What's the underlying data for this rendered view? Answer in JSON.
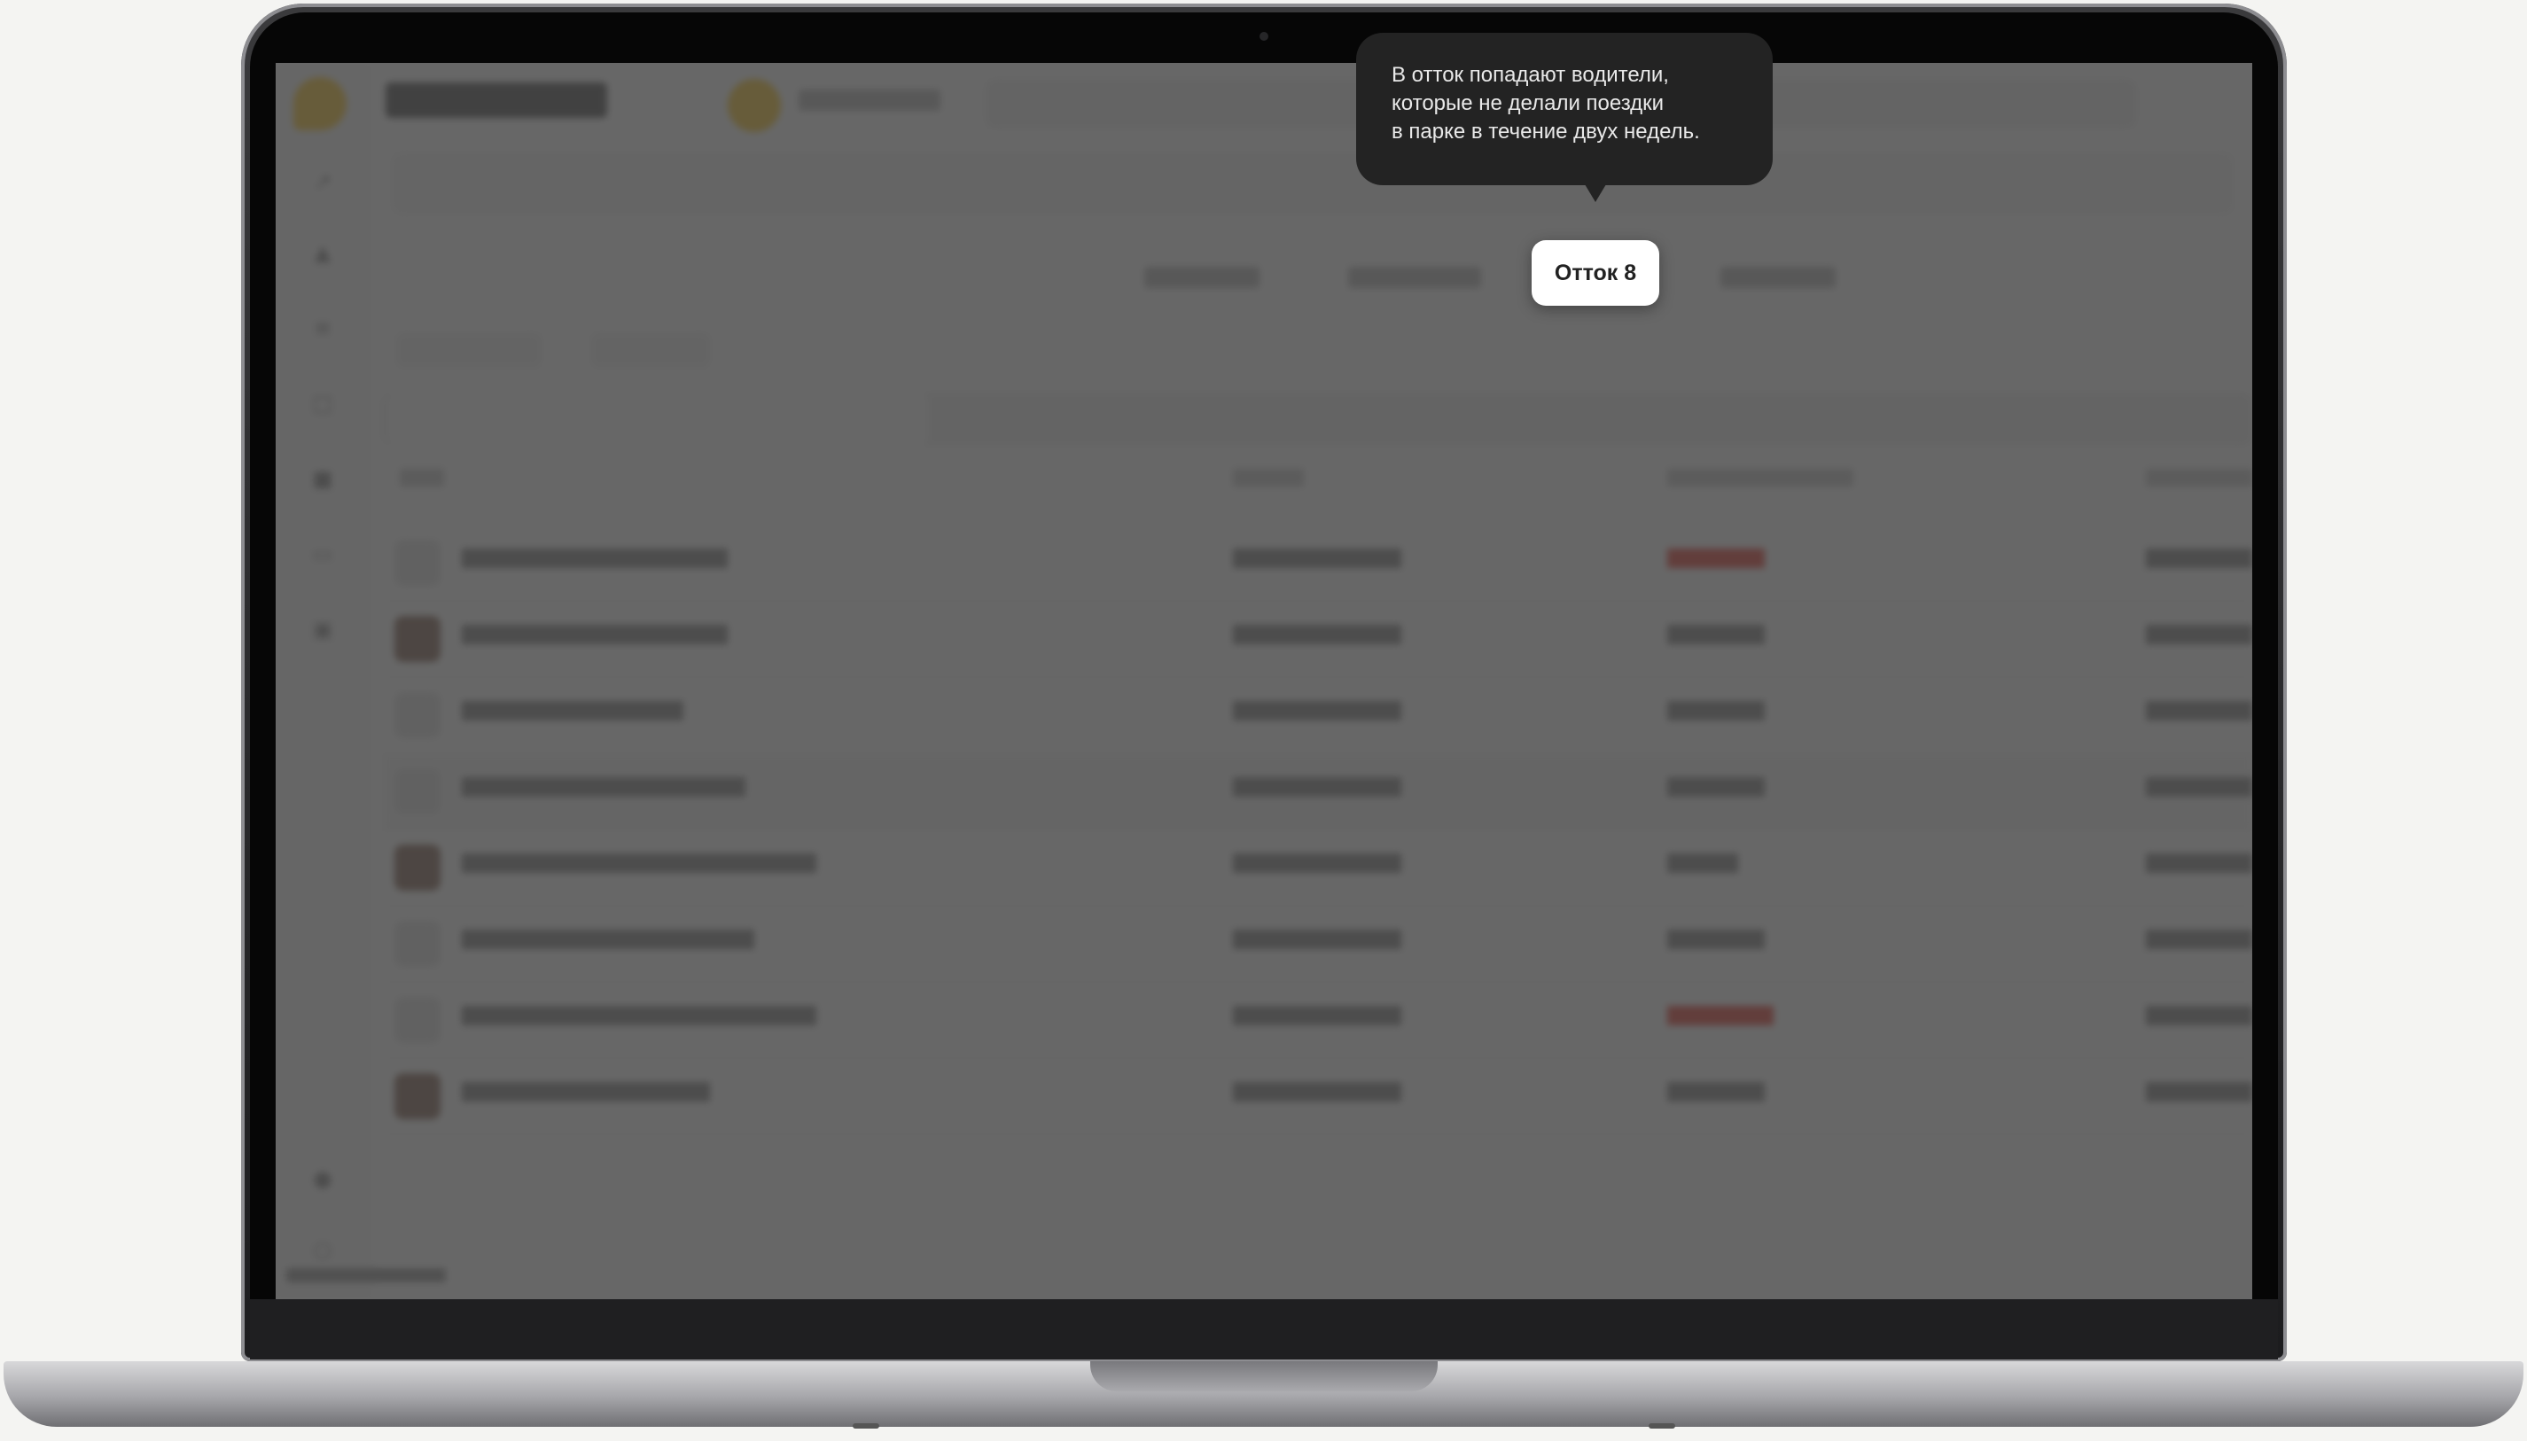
{
  "tooltip": {
    "line1": "В отток попадают водители,",
    "line2": "которые не делали поездки",
    "line3": "в парке в течение двух недель."
  },
  "highlighted_chip": {
    "label": "Отток 8"
  },
  "colors": {
    "tooltip_bg": "#232323",
    "chip_bg": "#ffffff",
    "brand_yellow": "#ffcc33",
    "dim_overlay": "#3c3c3c"
  },
  "icons": [
    "logo-icon",
    "camera-icon"
  ]
}
